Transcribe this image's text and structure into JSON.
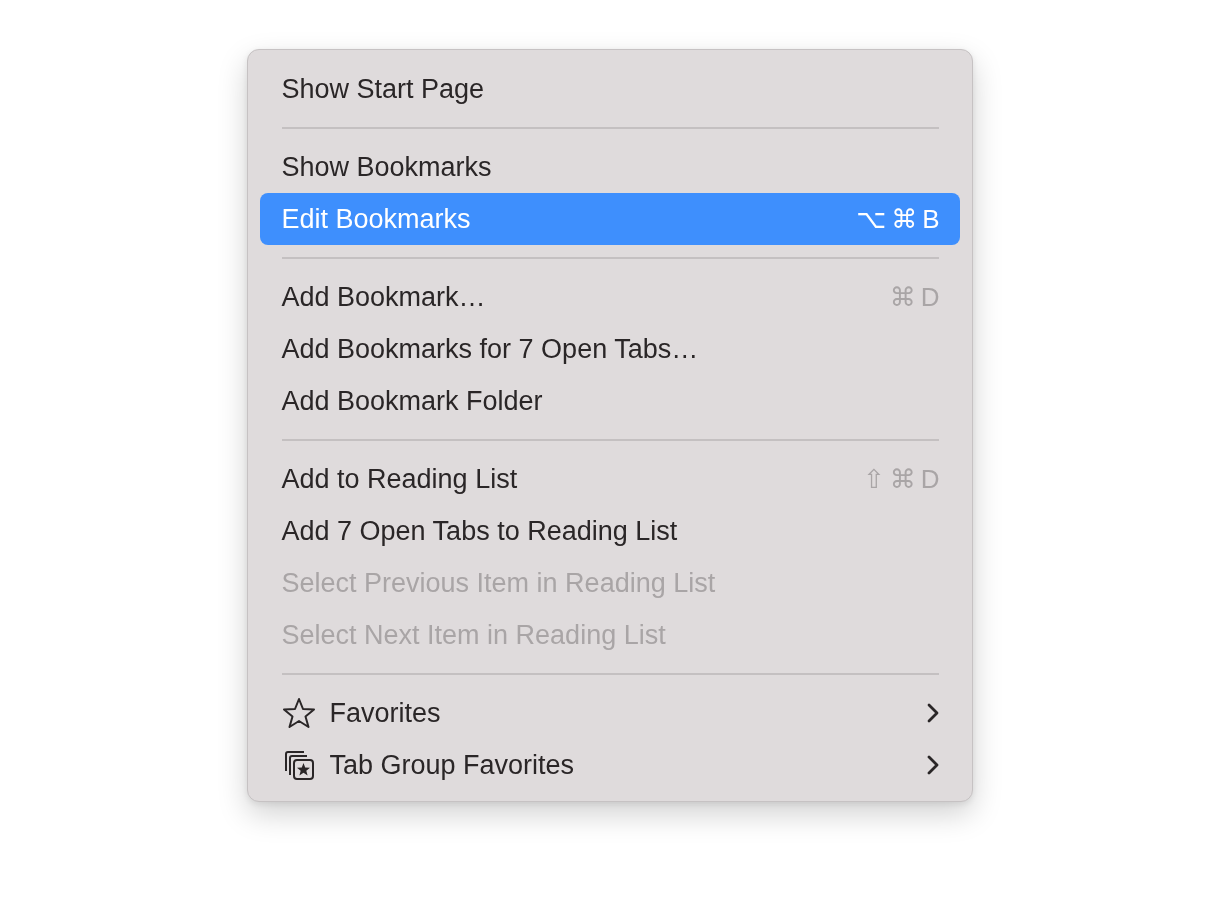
{
  "menu": {
    "sections": [
      [
        {
          "kind": "plain",
          "label": "Show Start Page",
          "selected": false,
          "disabled": false,
          "submenu": false
        }
      ],
      [
        {
          "kind": "plain",
          "label": "Show Bookmarks",
          "selected": false,
          "disabled": false,
          "submenu": false
        },
        {
          "kind": "plain",
          "label": "Edit Bookmarks",
          "shortcut": "⌥⌘B",
          "selected": true,
          "disabled": false,
          "submenu": false
        }
      ],
      [
        {
          "kind": "plain",
          "label": "Add Bookmark…",
          "shortcut": "⌘D",
          "selected": false,
          "disabled": false,
          "submenu": false
        },
        {
          "kind": "plain",
          "label": "Add Bookmarks for 7 Open Tabs…",
          "selected": false,
          "disabled": false,
          "submenu": false
        },
        {
          "kind": "plain",
          "label": "Add Bookmark Folder",
          "selected": false,
          "disabled": false,
          "submenu": false
        }
      ],
      [
        {
          "kind": "plain",
          "label": "Add to Reading List",
          "shortcut": "⇧⌘D",
          "selected": false,
          "disabled": false,
          "submenu": false
        },
        {
          "kind": "plain",
          "label": "Add 7 Open Tabs to Reading List",
          "selected": false,
          "disabled": false,
          "submenu": false
        },
        {
          "kind": "plain",
          "label": "Select Previous Item in Reading List",
          "selected": false,
          "disabled": true,
          "submenu": false
        },
        {
          "kind": "plain",
          "label": "Select Next Item in Reading List",
          "selected": false,
          "disabled": true,
          "submenu": false
        }
      ],
      [
        {
          "kind": "star",
          "label": "Favorites",
          "selected": false,
          "disabled": false,
          "submenu": true
        },
        {
          "kind": "tabgroup",
          "label": "Tab Group Favorites",
          "selected": false,
          "disabled": false,
          "submenu": true
        }
      ]
    ]
  }
}
